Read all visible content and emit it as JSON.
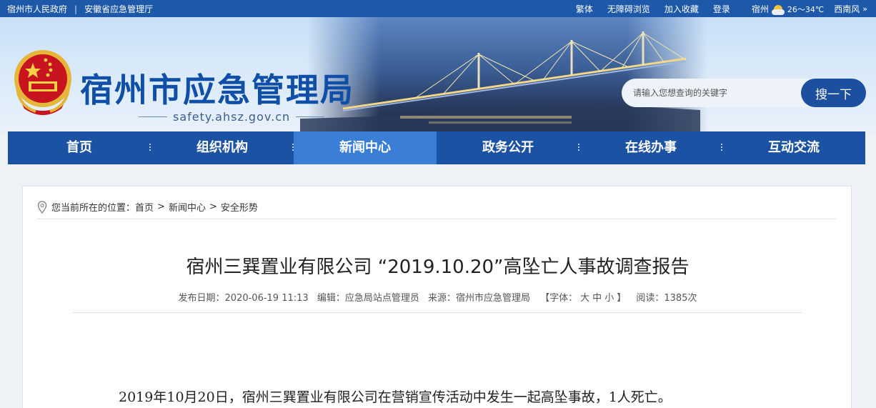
{
  "topbar": {
    "links_left": [
      "宿州市人民政府",
      "安徽省应急管理厅"
    ],
    "sep": "|",
    "links_right": [
      "繁体",
      "无障碍浏览",
      "加入收藏",
      "登录"
    ],
    "weather": {
      "city": "宿州",
      "temp": "26～34℃",
      "wind": "西南风",
      "chevron": "»"
    }
  },
  "header": {
    "site_title": "宿州市应急管理局",
    "domain": "safety.ahsz.gov.cn",
    "search": {
      "placeholder": "请输入您想查询的关键字",
      "button": "搜一下"
    }
  },
  "nav": {
    "items": [
      "首页",
      "组织机构",
      "新闻中心",
      "政务公开",
      "在线办事",
      "互动交流"
    ],
    "active": "新闻中心"
  },
  "breadcrumb": {
    "prefix": "您当前所在的位置：",
    "items": [
      "首页",
      "新闻中心",
      "安全形势"
    ],
    "sep": ">"
  },
  "article": {
    "title": "宿州三巽置业有限公司 “2019.10.20”高坠亡人事故调查报告",
    "meta": {
      "date": "发布日期：2020-06-19 11:13",
      "editor": "编辑：应急局站点管理员",
      "source": "来源：宿州市应急管理局",
      "font_prefix": "【字体：",
      "font_sizes": [
        "大",
        "中",
        "小"
      ],
      "font_suffix": "】",
      "views": "阅读：1385次"
    },
    "paragraph": "2019年10月20日，宿州三巽置业有限公司在营销宣传活动中发生一起高坠事故，1人死亡。"
  },
  "colors": {
    "primary": "#1c52a4",
    "active_nav": "#3a7fd5",
    "title_blue": "#0f4fa8"
  }
}
